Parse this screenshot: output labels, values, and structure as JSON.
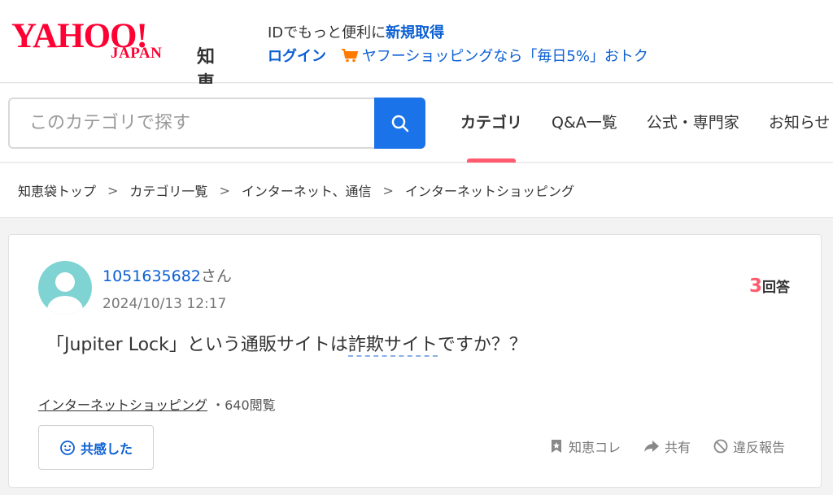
{
  "header": {
    "logo_yahoo": "YAHOO!",
    "logo_japan": "JAPAN",
    "logo_service": "知恵袋",
    "promo_prefix": "IDでもっと便利に",
    "promo_strong": "新規取得",
    "login_label": "ログイン",
    "shopping_promo": "ヤフーショッピングなら「毎日5%」おトク"
  },
  "search": {
    "placeholder": "このカテゴリで探す",
    "button_icon": "search-icon"
  },
  "nav": {
    "items": [
      "カテゴリ",
      "Q&A一覧",
      "公式・専門家",
      "お知らせ"
    ],
    "active": "カテゴリ"
  },
  "breadcrumb": [
    "知恵袋トップ",
    "カテゴリ一覧",
    "インターネット、通信",
    "インターネットショッピング"
  ],
  "question": {
    "user_id": "1051635682",
    "user_suffix": "さん",
    "datetime": "2024/10/13 12:17",
    "answer_count": "3",
    "answer_label": "回答",
    "text_before": "「Jupiter Lock」という通販サイトは",
    "text_underlined": "詐欺サイト",
    "text_after": "ですか？？",
    "category": "インターネットショッピング",
    "views": "・640閲覧",
    "empathy_label": "共感した",
    "actions": {
      "bookmark": "知恵コレ",
      "share": "共有",
      "report": "違反報告"
    }
  },
  "colors": {
    "brand_red": "#ff0033",
    "link_blue": "#0b5fd4",
    "search_blue": "#1a73e8",
    "accent_pink": "#ff5a6e"
  }
}
